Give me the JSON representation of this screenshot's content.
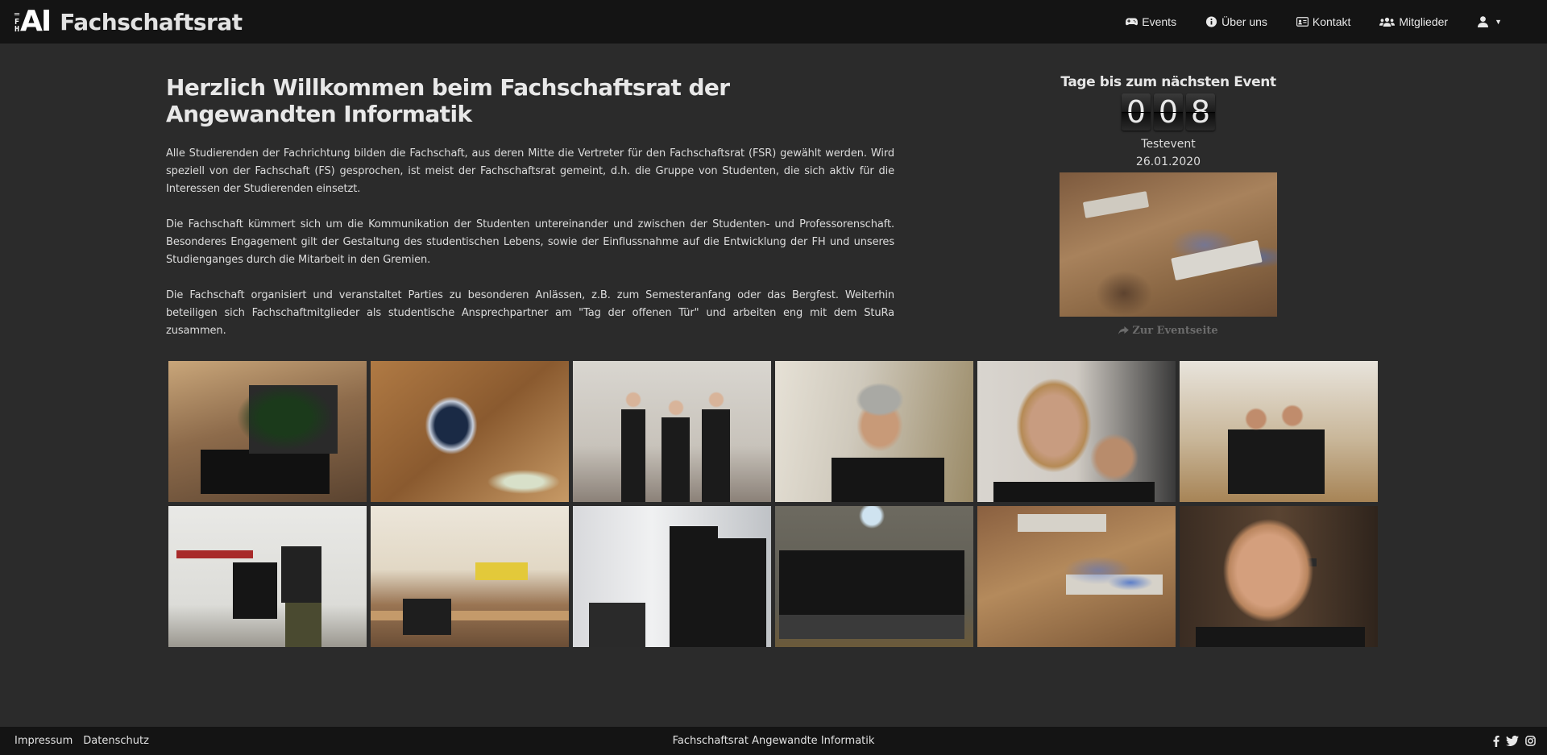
{
  "header": {
    "logo_fh": "FH",
    "logo_ai": "AI",
    "title": "Fachschaftsrat",
    "nav": [
      {
        "label": "Events",
        "icon": "gamepad-icon"
      },
      {
        "label": "Über uns",
        "icon": "info-circle-icon"
      },
      {
        "label": "Kontakt",
        "icon": "id-card-icon"
      },
      {
        "label": "Mitglieder",
        "icon": "users-icon"
      }
    ],
    "user_menu_icon": "user-icon"
  },
  "welcome": {
    "heading": "Herzlich Willkommen beim Fachschaftsrat der Angewandten Informatik",
    "paragraphs": [
      "Alle Studierenden der Fachrichtung bilden die Fachschaft, aus deren Mitte die Vertreter für den Fachschaftsrat (FSR) gewählt werden. Wird speziell von der Fachschaft (FS) gesprochen, ist meist der Fachschaftsrat gemeint, d.h. die Gruppe von Studenten, die sich aktiv für die Interessen der Studierenden einsetzt.",
      "Die Fachschaft kümmert sich um die Kommunikation der Studenten untereinander und zwischen der Studenten- und Professorenschaft. Besonderes Engagement gilt der Gestaltung des studentischen Lebens, sowie der Einflussnahme auf die Entwicklung der FH und unseres Studienganges durch die Mitarbeit in den Gremien.",
      "Die Fachschaft organisiert und veranstaltet Parties zu besonderen Anlässen, z.B. zum Semesteranfang oder das Bergfest. Weiterhin beteiligen sich Fachschaftmitglieder als studentische Ansprechpartner am \"Tag der offenen Tür\" und arbeiten eng mit dem StuRa zusammen."
    ]
  },
  "countdown": {
    "title": "Tage bis zum nächsten Event",
    "digits": [
      "0",
      "0",
      "8"
    ],
    "event_name": "Testevent",
    "event_date": "26.01.2020",
    "link_label": "Zur Eventseite"
  },
  "footer": {
    "links": [
      "Impressum",
      "Datenschutz"
    ],
    "center": "Fachschaftsrat Angewandte Informatik",
    "social": [
      "facebook-icon",
      "twitter-icon",
      "instagram-icon"
    ]
  }
}
